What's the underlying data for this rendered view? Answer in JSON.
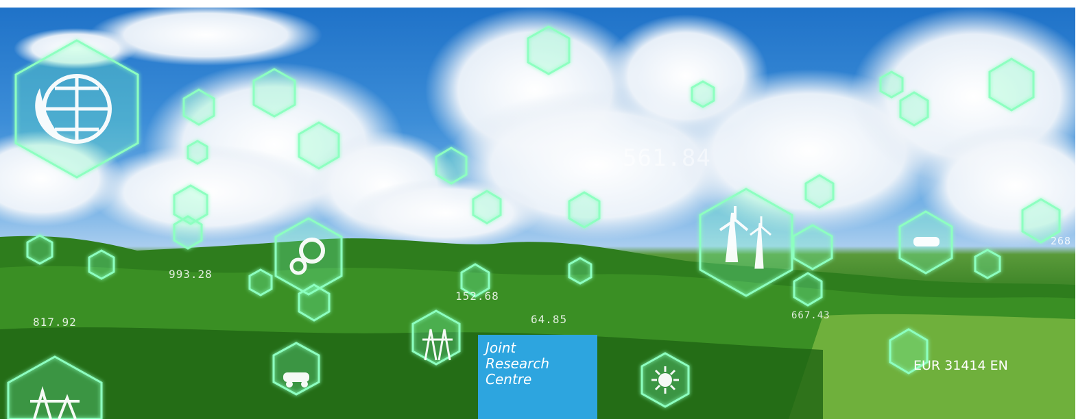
{
  "logo": {
    "line1": "Joint",
    "line2": "Research",
    "line3": "Centre",
    "background_color": "#2da5df"
  },
  "report_number": "EUR 31414 EN",
  "decorative_numbers": {
    "n1": "561.84",
    "n2": "993.28",
    "n3": "817.92",
    "n4": "152.68",
    "n5": "64.85",
    "n6": "667.43",
    "n7": "268"
  },
  "icons": [
    "globe-leaf-icon",
    "gear-icon",
    "leaf-hand-icon",
    "pie-chart-icon",
    "wind-turbine-icon",
    "recycle-icon",
    "electric-car-icon",
    "power-tower-icon",
    "sun-icon",
    "water-drop-icon",
    "location-pin-icon",
    "factory-icon",
    "bar-chart-icon"
  ],
  "accent_colors": {
    "glow": "#7dffb0",
    "hex_fill": "rgba(120,255,190,0.18)"
  }
}
